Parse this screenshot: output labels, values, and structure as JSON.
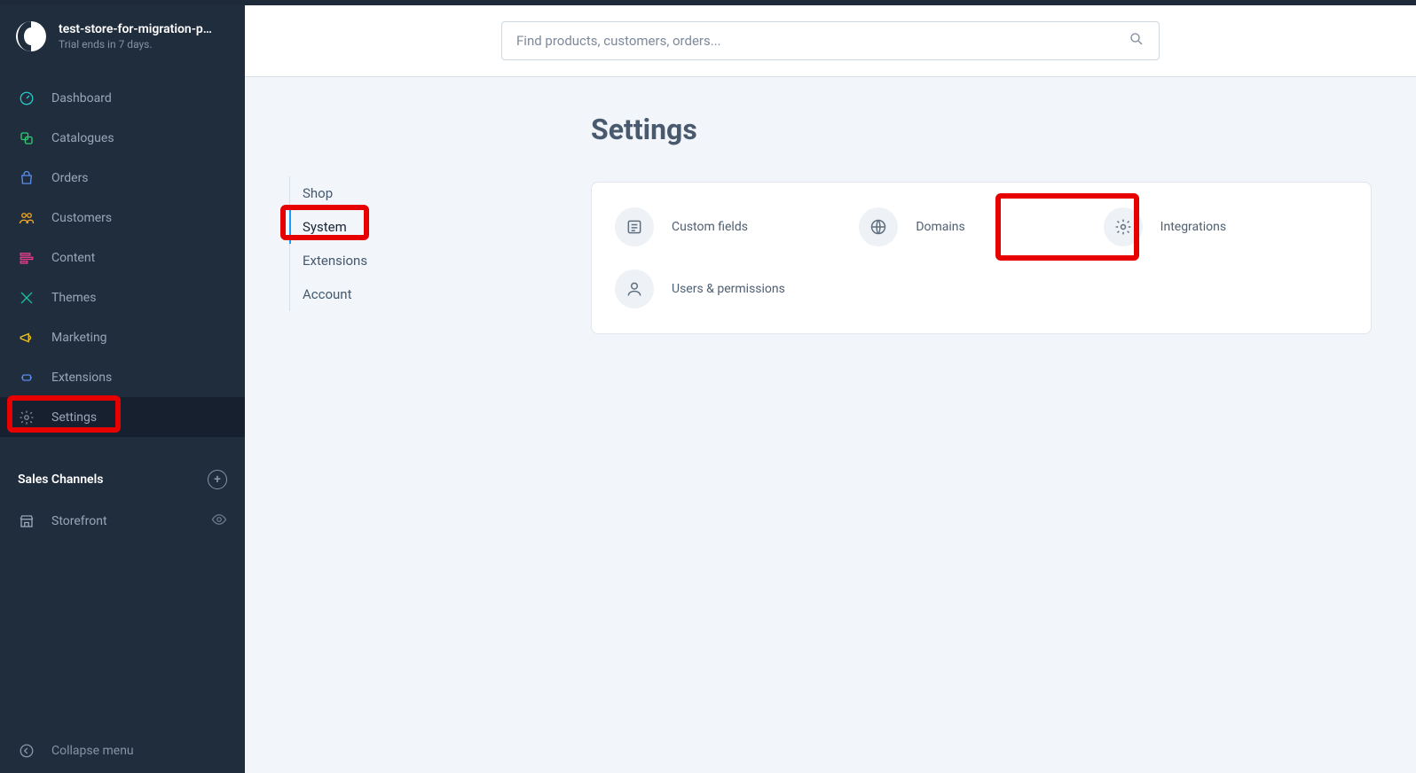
{
  "store": {
    "name": "test-store-for-migration-p…",
    "subtext": "Trial ends in 7 days."
  },
  "nav": {
    "items": [
      {
        "label": "Dashboard"
      },
      {
        "label": "Catalogues"
      },
      {
        "label": "Orders"
      },
      {
        "label": "Customers"
      },
      {
        "label": "Content"
      },
      {
        "label": "Themes"
      },
      {
        "label": "Marketing"
      },
      {
        "label": "Extensions"
      },
      {
        "label": "Settings"
      }
    ]
  },
  "sales_channels": {
    "header": "Sales Channels",
    "items": [
      {
        "label": "Storefront"
      }
    ]
  },
  "footer": {
    "collapse": "Collapse menu"
  },
  "search": {
    "placeholder": "Find products, customers, orders..."
  },
  "page": {
    "title": "Settings",
    "tabs": [
      {
        "label": "Shop"
      },
      {
        "label": "System"
      },
      {
        "label": "Extensions"
      },
      {
        "label": "Account"
      }
    ],
    "items": [
      {
        "label": "Custom fields"
      },
      {
        "label": "Domains"
      },
      {
        "label": "Integrations"
      },
      {
        "label": "Users & permissions"
      }
    ]
  }
}
